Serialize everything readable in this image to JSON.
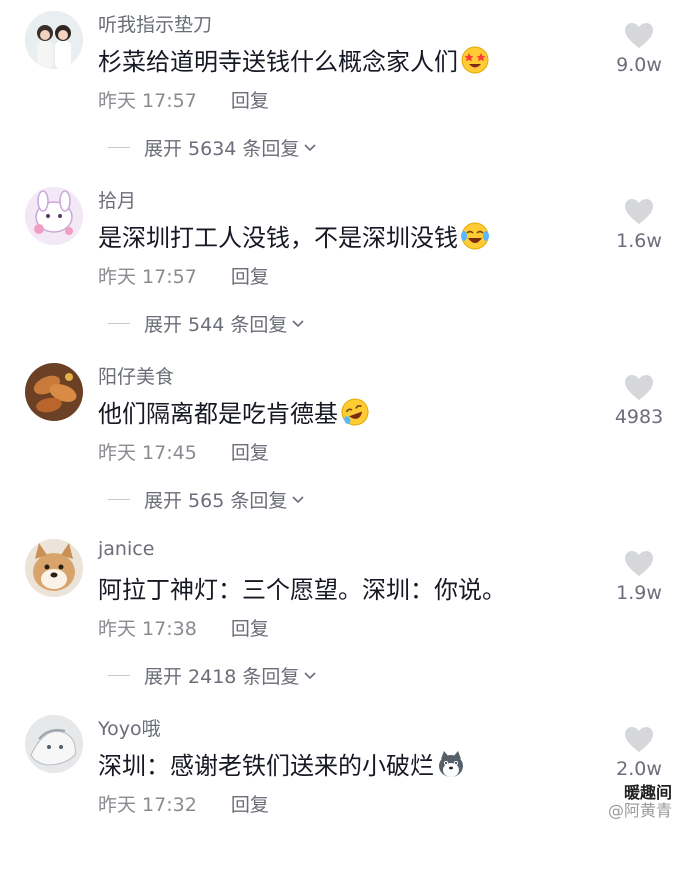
{
  "comments": [
    {
      "username": "听我指示垫刀",
      "text": "杉菜给道明寺送钱什么概念家人们",
      "emoji": "star-struck-emoji",
      "time": "昨天 17:57",
      "reply": "回复",
      "expand": "展开 5634 条回复",
      "likes": "9.0w",
      "avatar_color": "#e9eef1"
    },
    {
      "username": "拾月",
      "text": "是深圳打工人没钱，不是深圳没钱",
      "emoji": "crying-laughing-emoji",
      "time": "昨天 17:57",
      "reply": "回复",
      "expand": "展开 544 条回复",
      "likes": "1.6w",
      "avatar_color": "#f3e9f6"
    },
    {
      "username": "阳仔美食",
      "text": "他们隔离都是吃肯德基",
      "emoji": "rofl-emoji",
      "time": "昨天 17:45",
      "reply": "回复",
      "expand": "展开 565 条回复",
      "likes": "4983",
      "avatar_color": "#8a5a33"
    },
    {
      "username": "janice",
      "text": "阿拉丁神灯：三个愿望。深圳：你说。",
      "emoji": "",
      "time": "昨天 17:38",
      "reply": "回复",
      "expand": "展开 2418 条回复",
      "likes": "1.9w",
      "avatar_color": "#d9a46b"
    },
    {
      "username": "Yoyo哦",
      "text": "深圳：感谢老铁们送来的小破烂",
      "emoji": "husky-emoji",
      "time": "昨天 17:32",
      "reply": "回复",
      "expand": "",
      "likes": "2.0w",
      "avatar_color": "#e6e8ea"
    }
  ],
  "watermark": {
    "brand": "暖趣间",
    "handle": "@阿黄青"
  }
}
